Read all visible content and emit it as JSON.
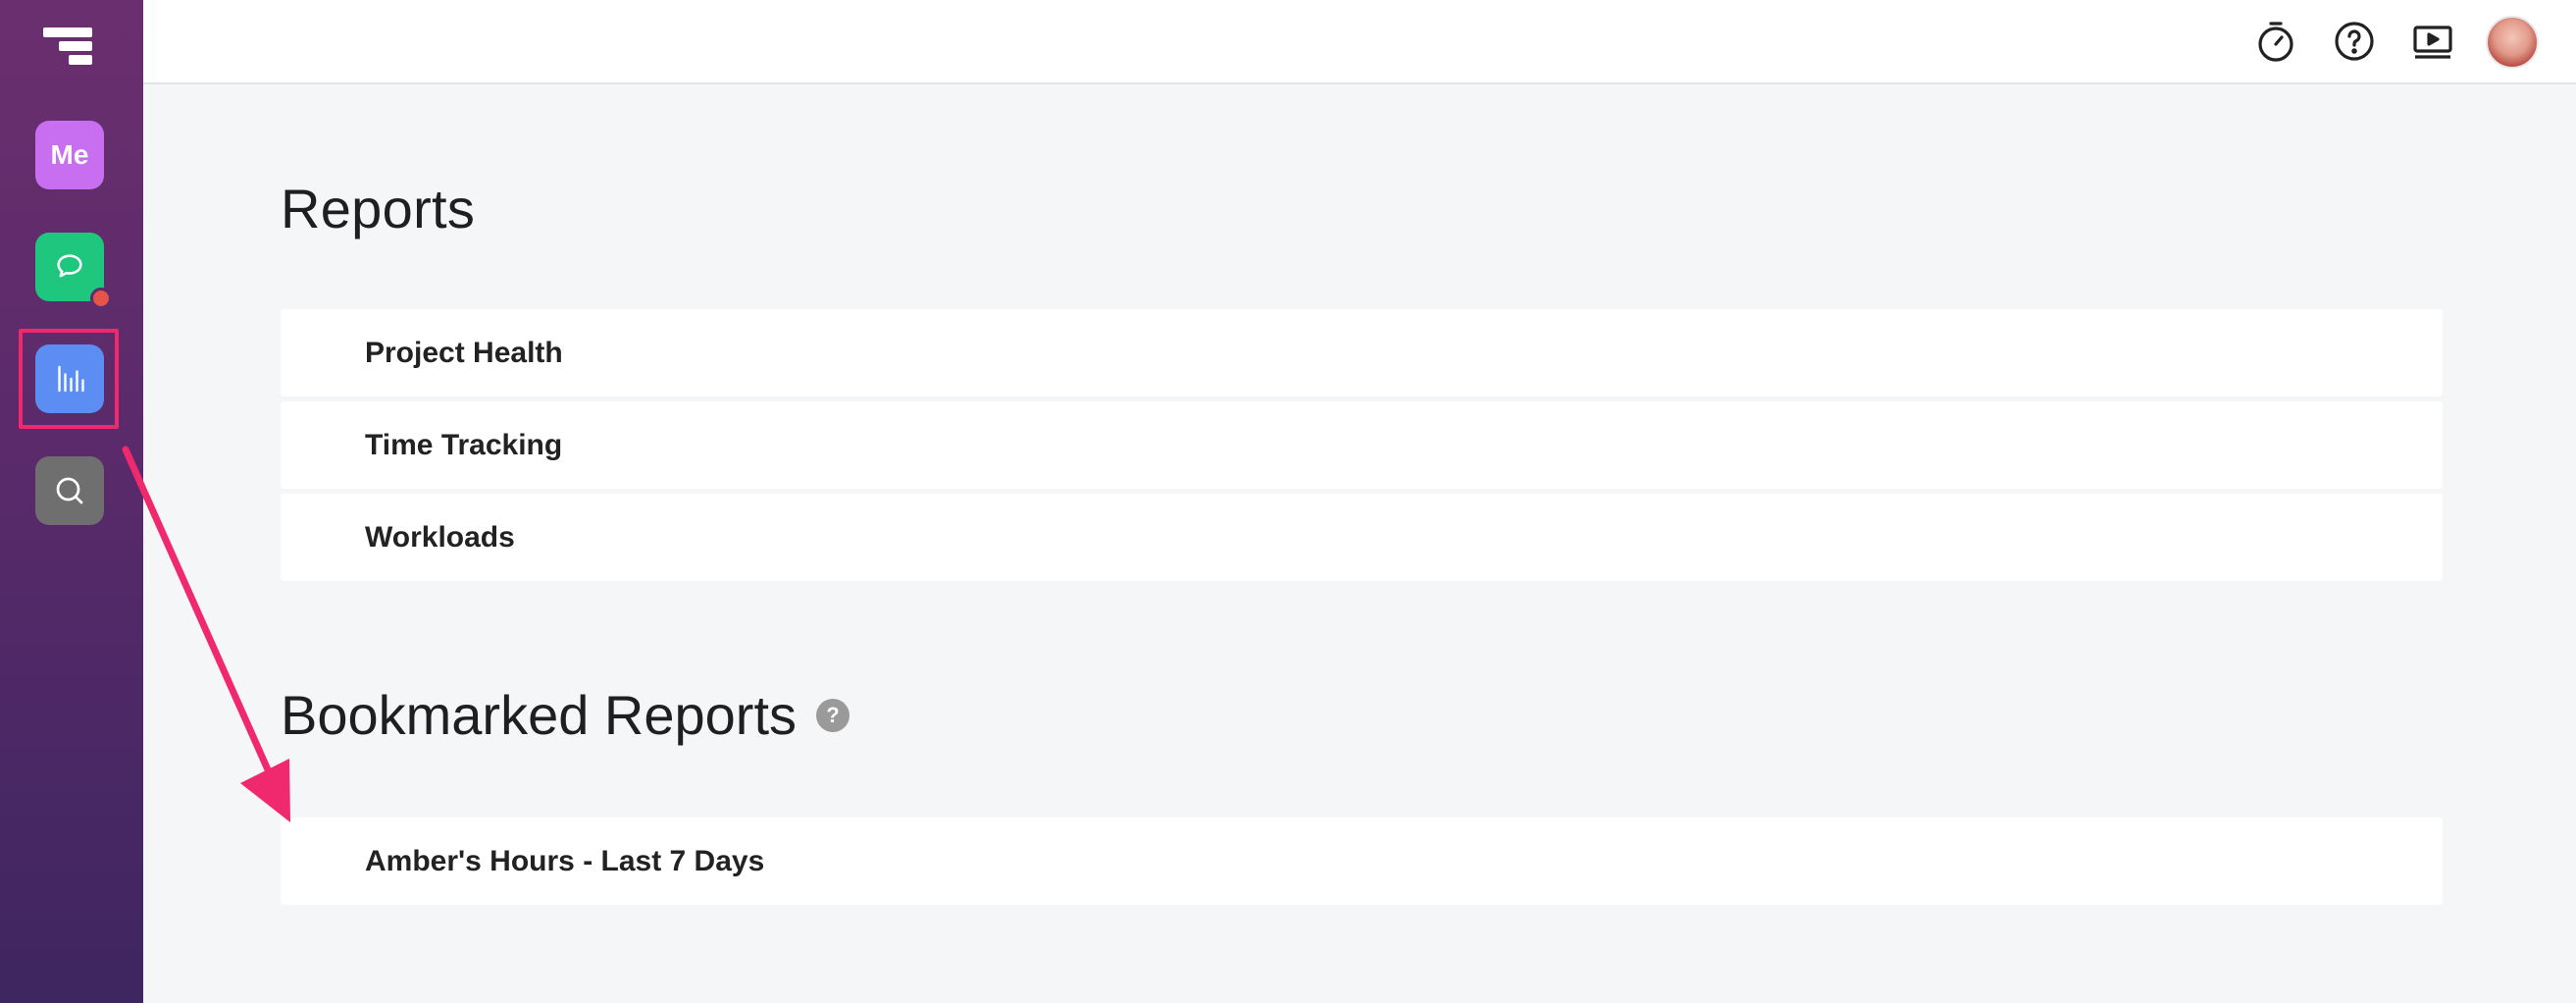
{
  "sidebar": {
    "me_label": "Me"
  },
  "main": {
    "title": "Reports",
    "reports": [
      {
        "label": "Project Health"
      },
      {
        "label": "Time Tracking"
      },
      {
        "label": "Workloads"
      }
    ],
    "bookmarked_title": "Bookmarked Reports",
    "help_glyph": "?",
    "bookmarked": [
      {
        "label": "Amber's Hours - Last 7 Days"
      }
    ]
  },
  "colors": {
    "sidebar_gradient": [
      "#6a2f6e",
      "#3e2660"
    ],
    "me_button": "#c86ef0",
    "chat_button": "#1fc77e",
    "reports_button": "#5c8df2",
    "search_button": "#6f6f70",
    "annotation": "#f0296e"
  },
  "icons": [
    "app-logo-icon",
    "chat-bubble-icon",
    "bar-chart-icon",
    "search-icon",
    "timer-icon",
    "help-circle-icon",
    "video-player-icon"
  ]
}
